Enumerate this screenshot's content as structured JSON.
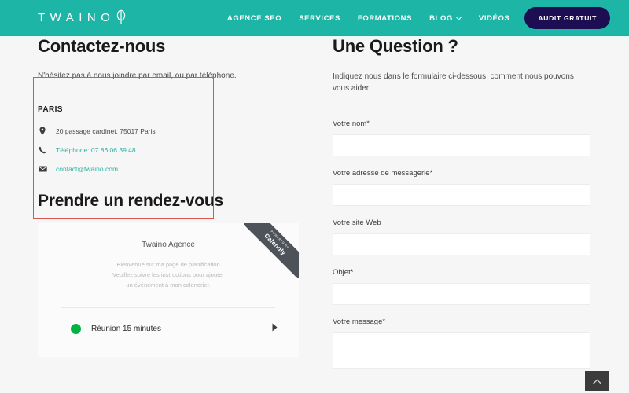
{
  "header": {
    "logo_text": "TWAINO",
    "logo_icon": "leaf-icon",
    "nav": [
      {
        "label": "AGENCE SEO",
        "name": "agence-seo"
      },
      {
        "label": "SERVICES",
        "name": "services"
      },
      {
        "label": "FORMATIONS",
        "name": "formations"
      },
      {
        "label": "BLOG",
        "name": "blog",
        "has_caret": true
      },
      {
        "label": "VIDÉOS",
        "name": "videos"
      }
    ],
    "cta_label": "AUDIT GRATUIT",
    "teal": "#1db5a6",
    "cta_color": "#1d0d52"
  },
  "contact": {
    "title": "Contactez-nous",
    "lead": "N'hésitez pas à nous joindre par email, ou par téléphone.",
    "city": "PARIS",
    "address_icon": "map-pin-icon",
    "address": "20 passage cardinet, 75017 Paris",
    "phone_icon": "phone-icon",
    "phone": "Téléphone: 07 86 06 39 48",
    "email_icon": "envelope-icon",
    "email": "contact@twaino.com",
    "link_color": "#29b3a3",
    "highlight_color": "#d9534f"
  },
  "appointment": {
    "title": "Prendre un rendez-vous",
    "owner": "Twaino Agence",
    "description_lines": [
      "Bienvenue sur ma page de planification",
      "Veuillez suivre les instructions pour ajouter",
      "un événement à mon calendrier."
    ],
    "event_label": "Réunion 15 minutes",
    "event_dot_color": "#00b341",
    "arrow_icon": "chevron-right-icon",
    "ribbon_top": "Powered by",
    "ribbon_brand": "Calendly"
  },
  "form": {
    "title": "Une Question ?",
    "lead": "Indiquez nous dans le formulaire ci-dessous, comment nous pouvons vous aider.",
    "fields": [
      {
        "label": "Votre nom*",
        "name": "votre-nom",
        "value": "",
        "placeholder": "",
        "type": "text"
      },
      {
        "label": "Votre adresse de messagerie*",
        "name": "adresse-messagerie",
        "value": "",
        "placeholder": "",
        "type": "text"
      },
      {
        "label": "Votre site Web",
        "name": "site-web",
        "value": "",
        "placeholder": "",
        "type": "text"
      },
      {
        "label": "Objet*",
        "name": "objet",
        "value": "",
        "placeholder": "",
        "type": "text"
      },
      {
        "label": "Votre message*",
        "name": "votre-message",
        "value": "",
        "placeholder": "",
        "type": "textarea"
      }
    ]
  },
  "scroll_top": {
    "icon": "chevron-up-icon"
  }
}
